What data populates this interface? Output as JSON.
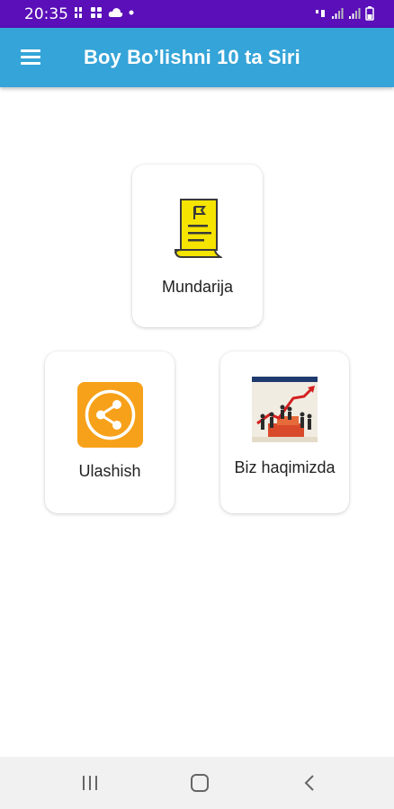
{
  "status_bar": {
    "time": "20:35",
    "background": "#5a0fb8"
  },
  "app_bar": {
    "title": "Boy Bo’lishni 10 ta Siri",
    "background": "#35a4d8"
  },
  "cards": {
    "mundarija": {
      "label": "Mundarija",
      "icon": "document-scroll-icon"
    },
    "ulashish": {
      "label": "Ulashish",
      "icon": "share-icon"
    },
    "biz": {
      "label": "Biz haqimizda",
      "icon": "about-us-image-icon"
    }
  },
  "nav_bar": {
    "buttons": [
      "recent-apps-icon",
      "home-icon",
      "back-icon"
    ]
  }
}
